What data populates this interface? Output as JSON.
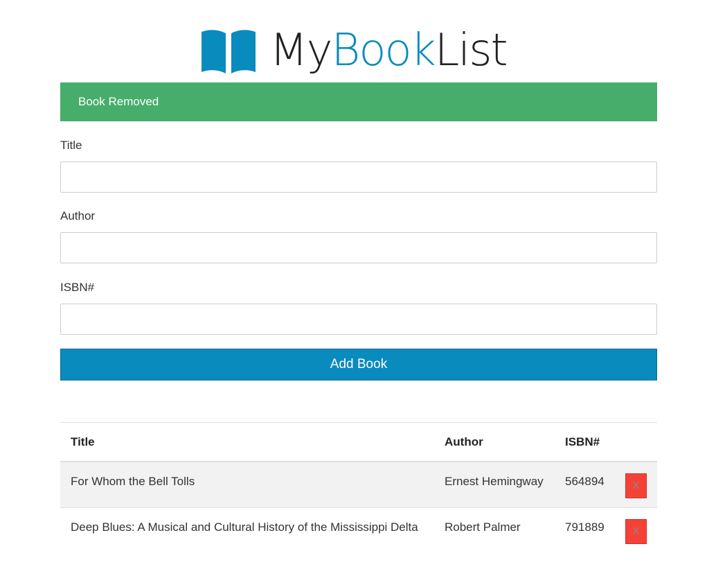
{
  "brand": {
    "part1": "My",
    "part2": "Book",
    "part3": "List",
    "icon": "open-book-icon",
    "accent_color": "#0a8bbd"
  },
  "alert": {
    "message": "Book Removed",
    "color": "#46ad6b"
  },
  "form": {
    "title_label": "Title",
    "title_value": "",
    "author_label": "Author",
    "author_value": "",
    "isbn_label": "ISBN#",
    "isbn_value": "",
    "submit_label": "Add Book"
  },
  "table": {
    "headers": [
      "Title",
      "Author",
      "ISBN#"
    ],
    "rows": [
      {
        "title": "For Whom the Bell Tolls",
        "author": "Ernest Hemingway",
        "isbn": "564894",
        "delete_label": "X"
      },
      {
        "title": "Deep Blues: A Musical and Cultural History of the Mississippi Delta",
        "author": "Robert Palmer",
        "isbn": "791889",
        "delete_label": "X"
      }
    ],
    "delete_color": "#f44336"
  }
}
